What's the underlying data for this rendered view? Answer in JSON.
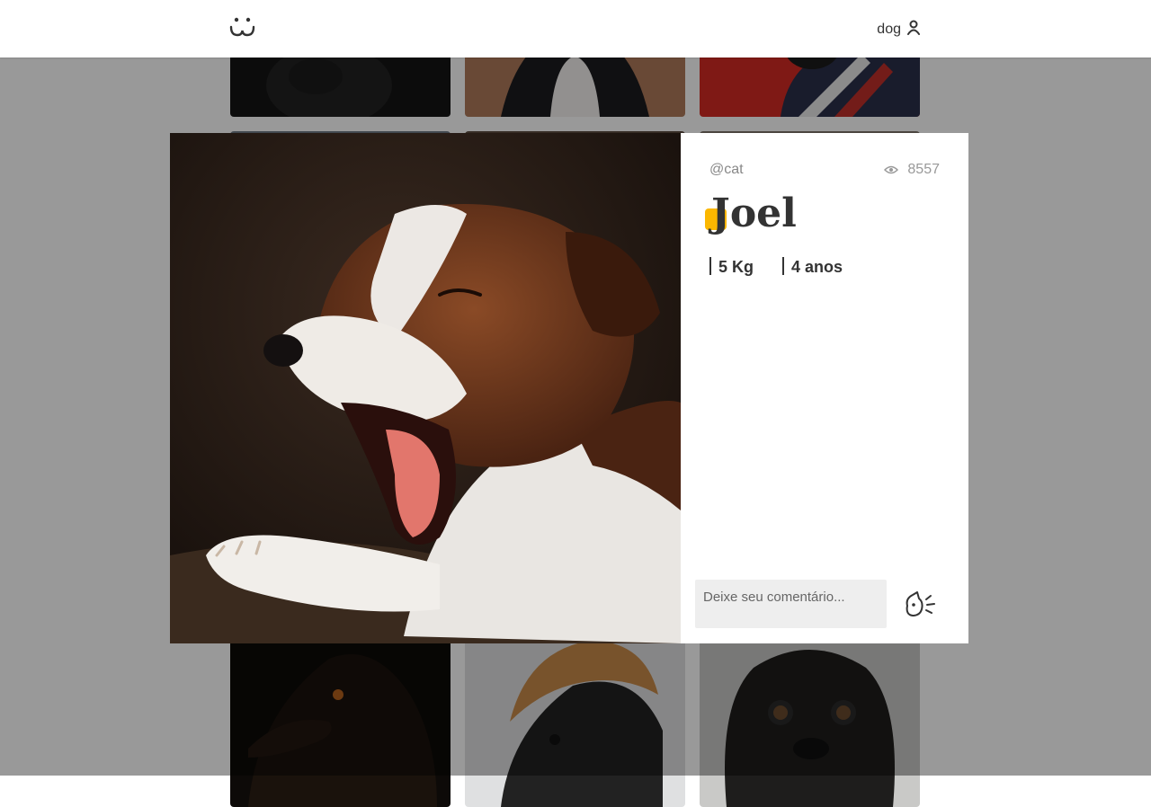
{
  "header": {
    "logo_icon": "dog-face-logo-icon",
    "username": "dog",
    "user_icon": "user-icon"
  },
  "feed": {
    "tile_count": 9
  },
  "photo_modal": {
    "author": "@cat",
    "views": "8557",
    "view_icon": "eye-icon",
    "title": "Joel",
    "weight": "5 Kg",
    "age": "4 anos",
    "comment_placeholder": "Deixe seu comentário...",
    "send_icon": "dog-bark-send-icon",
    "accent_color": "#fbb700"
  }
}
